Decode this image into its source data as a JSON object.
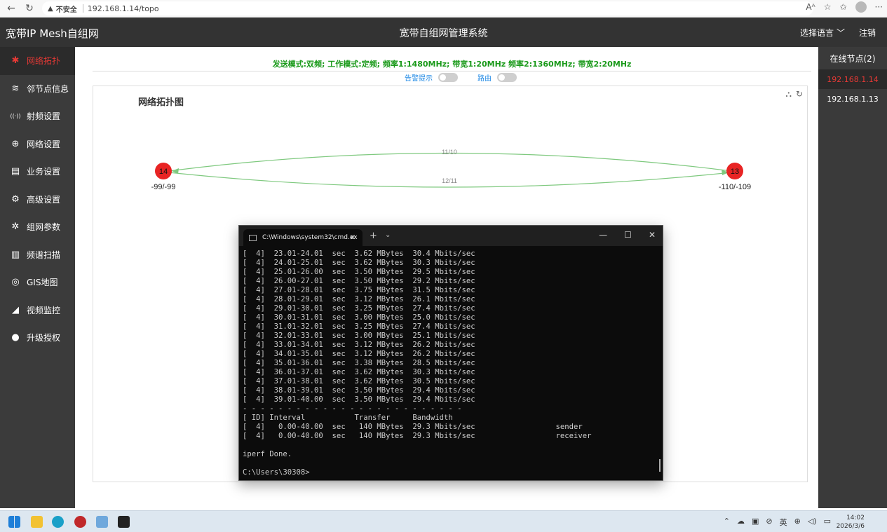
{
  "browser": {
    "insecure_label": "不安全",
    "url": "192.168.1.14/topo"
  },
  "header": {
    "brand": "宽带IP Mesh自组网",
    "system_title": "宽带自组网管理系统",
    "language": "选择语言",
    "logout": "注销"
  },
  "sidebar": {
    "items": [
      {
        "label": "网络拓扑",
        "icon": "topology-icon",
        "glyph": "✱"
      },
      {
        "label": "邻节点信息",
        "icon": "neighbor-icon",
        "glyph": "≋"
      },
      {
        "label": "射频设置",
        "icon": "antenna-icon",
        "glyph": "((·))"
      },
      {
        "label": "网络设置",
        "icon": "globe-icon",
        "glyph": "⊕"
      },
      {
        "label": "业务设置",
        "icon": "service-icon",
        "glyph": "▤"
      },
      {
        "label": "高级设置",
        "icon": "gear-icon",
        "glyph": "⚙"
      },
      {
        "label": "组网参数",
        "icon": "network-param-icon",
        "glyph": "✲"
      },
      {
        "label": "频谱扫描",
        "icon": "spectrum-icon",
        "glyph": "▥"
      },
      {
        "label": "GIS地图",
        "icon": "map-pin-icon",
        "glyph": "◎"
      },
      {
        "label": "视频监控",
        "icon": "camera-icon",
        "glyph": "◢"
      },
      {
        "label": "升级授权",
        "icon": "upgrade-icon",
        "glyph": "●"
      }
    ]
  },
  "main": {
    "mode_line": "发送模式:双频;   工作模式:定频;   频率1:1480MHz;   带宽1:20MHz   频率2:1360MHz;   带宽2:20MHz",
    "alarm_label": "告警提示",
    "route_label": "路由",
    "topo_title": "网络拓扑图"
  },
  "topology": {
    "nodes": [
      {
        "id": "14",
        "signal": "-99/-99"
      },
      {
        "id": "13",
        "signal": "-110/-109"
      }
    ],
    "links": [
      {
        "label": "11/10"
      },
      {
        "label": "12/11"
      }
    ],
    "node_color": "#e82424",
    "link_color": "#7fc97f"
  },
  "right_panel": {
    "title": "在线节点(2)",
    "nodes": [
      "192.168.1.14",
      "192.168.1.13"
    ]
  },
  "terminal": {
    "tab_title": "C:\\Windows\\system32\\cmd.ex",
    "lines": [
      "[  4]  23.01-24.01  sec  3.62 MBytes  30.4 Mbits/sec",
      "[  4]  24.01-25.01  sec  3.62 MBytes  30.3 Mbits/sec",
      "[  4]  25.01-26.00  sec  3.50 MBytes  29.5 Mbits/sec",
      "[  4]  26.00-27.01  sec  3.50 MBytes  29.2 Mbits/sec",
      "[  4]  27.01-28.01  sec  3.75 MBytes  31.5 Mbits/sec",
      "[  4]  28.01-29.01  sec  3.12 MBytes  26.1 Mbits/sec",
      "[  4]  29.01-30.01  sec  3.25 MBytes  27.4 Mbits/sec",
      "[  4]  30.01-31.01  sec  3.00 MBytes  25.0 Mbits/sec",
      "[  4]  31.01-32.01  sec  3.25 MBytes  27.4 Mbits/sec",
      "[  4]  32.01-33.01  sec  3.00 MBytes  25.1 Mbits/sec",
      "[  4]  33.01-34.01  sec  3.12 MBytes  26.2 Mbits/sec",
      "[  4]  34.01-35.01  sec  3.12 MBytes  26.2 Mbits/sec",
      "[  4]  35.01-36.01  sec  3.38 MBytes  28.5 Mbits/sec",
      "[  4]  36.01-37.01  sec  3.62 MBytes  30.3 Mbits/sec",
      "[  4]  37.01-38.01  sec  3.62 MBytes  30.5 Mbits/sec",
      "[  4]  38.01-39.01  sec  3.50 MBytes  29.4 Mbits/sec",
      "[  4]  39.01-40.00  sec  3.50 MBytes  29.4 Mbits/sec",
      "- - - - - - - - - - - - - - - - - - - - - - - - -",
      "[ ID] Interval           Transfer     Bandwidth",
      "[  4]   0.00-40.00  sec   140 MBytes  29.3 Mbits/sec                  sender",
      "[  4]   0.00-40.00  sec   140 MBytes  29.3 Mbits/sec                  receiver",
      "",
      "iperf Done.",
      "",
      "C:\\Users\\30308>"
    ]
  },
  "taskbar": {
    "ime": "英",
    "time": "14:02",
    "date": "2026/3/6"
  }
}
